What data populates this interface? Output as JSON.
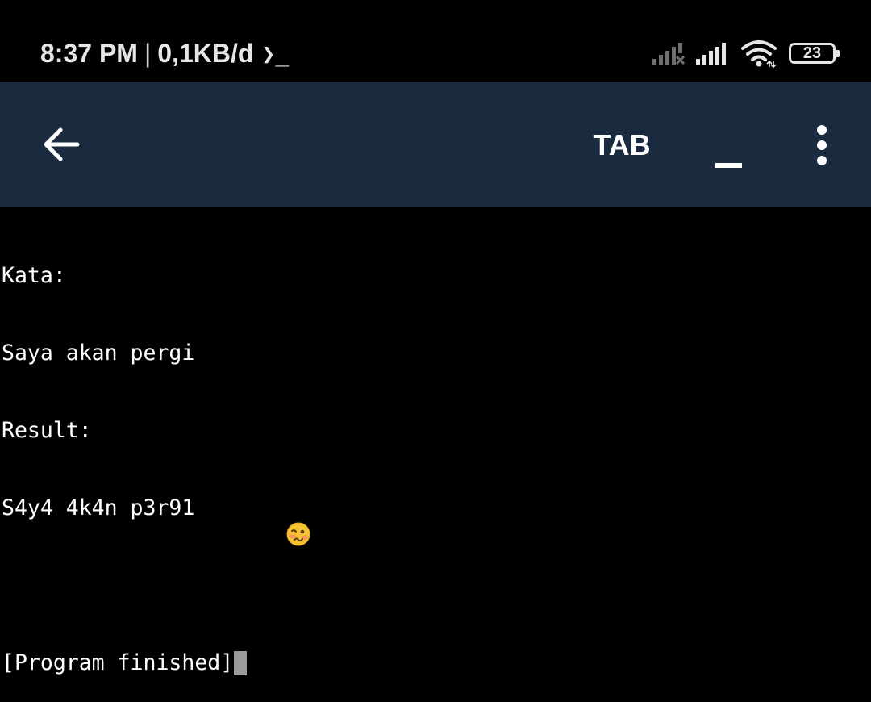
{
  "status_bar": {
    "time": "8:37 PM",
    "separator": "|",
    "network_speed": "0,1KB/d",
    "terminal_indicator": "❯_",
    "battery_level": "23",
    "battery_fraction": 0.23,
    "icons": [
      "signal-off-icon",
      "signal-icon",
      "wifi-icon",
      "battery-icon"
    ]
  },
  "toolbar": {
    "background_color": "#1a2b40",
    "back_icon": "arrow-left-icon",
    "tab_label": "TAB",
    "underscore_label": "_",
    "more_icon": "more-vertical-icon"
  },
  "terminal": {
    "lines": [
      "Kata:",
      "Saya akan pergi",
      "Result:",
      "S4y4 4k4n p3r91",
      "",
      "[Program finished]"
    ],
    "emoji_icon": "woozy-face-icon"
  }
}
